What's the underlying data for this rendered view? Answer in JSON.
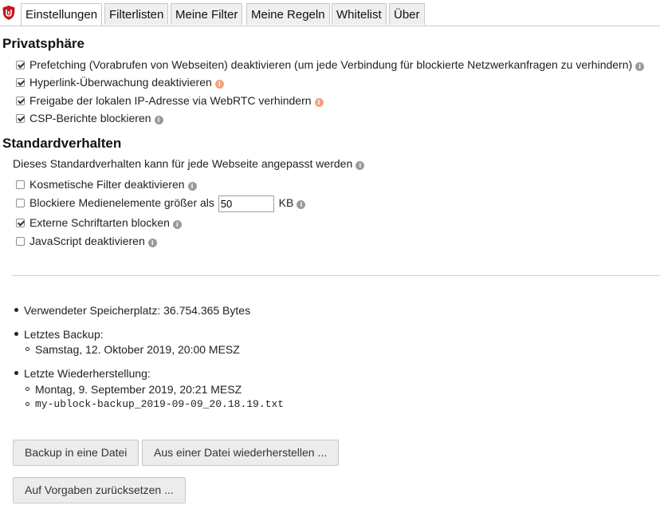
{
  "header": {
    "logo_icon": "ublock-shield-icon",
    "tabs": [
      {
        "label": "Einstellungen",
        "active": true
      },
      {
        "label": "Filterlisten"
      },
      {
        "label": "Meine Filter"
      },
      {
        "label": "Meine Regeln"
      },
      {
        "label": "Whitelist"
      },
      {
        "label": "Über"
      }
    ]
  },
  "privacy": {
    "title": "Privatsphäre",
    "items": [
      {
        "label": "Prefetching (Vorabrufen von Webseiten) deaktivieren (um jede Verbindung für blockierte Netzwerkanfragen zu verhindern)",
        "checked": true,
        "info": "info-icon"
      },
      {
        "label": "Hyperlink-Überwachung deaktivieren",
        "checked": true,
        "info": "warning-info-icon"
      },
      {
        "label": "Freigabe der lokalen IP-Adresse via WebRTC verhindern",
        "checked": true,
        "info": "warning-info-icon"
      },
      {
        "label": "CSP-Berichte blockieren",
        "checked": true,
        "info": "info-icon"
      }
    ]
  },
  "defaults": {
    "title": "Standardverhalten",
    "description": "Dieses Standardverhalten kann für jede Webseite angepasst werden",
    "items": [
      {
        "label": "Kosmetische Filter deaktivieren",
        "checked": false
      },
      {
        "label": "Blockiere Medienelemente größer als",
        "checked": false,
        "input_value": "50",
        "unit": "KB"
      },
      {
        "label": "Externe Schriftarten blocken",
        "checked": true
      },
      {
        "label": "JavaScript deaktivieren",
        "checked": false
      }
    ]
  },
  "storage": {
    "used": "Verwendeter Speicherplatz: 36.754.365 Bytes",
    "last_backup_label": "Letztes Backup:",
    "last_backup_date": "Samstag, 12. Oktober 2019, 20:00 MESZ",
    "last_restore_label": "Letzte Wiederherstellung:",
    "last_restore_date": "Montag, 9. September 2019, 20:21 MESZ",
    "last_restore_file": "my-ublock-backup_2019-09-09_20.18.19.txt"
  },
  "buttons": {
    "backup": "Backup in eine Datei",
    "restore": "Aus einer Datei wiederherstellen ...",
    "reset": "Auf Vorgaben zurücksetzen ..."
  },
  "colors": {
    "info_icon": "#9a9a9a",
    "warning_icon": "#f2a37f",
    "logo": "#c4161c"
  }
}
